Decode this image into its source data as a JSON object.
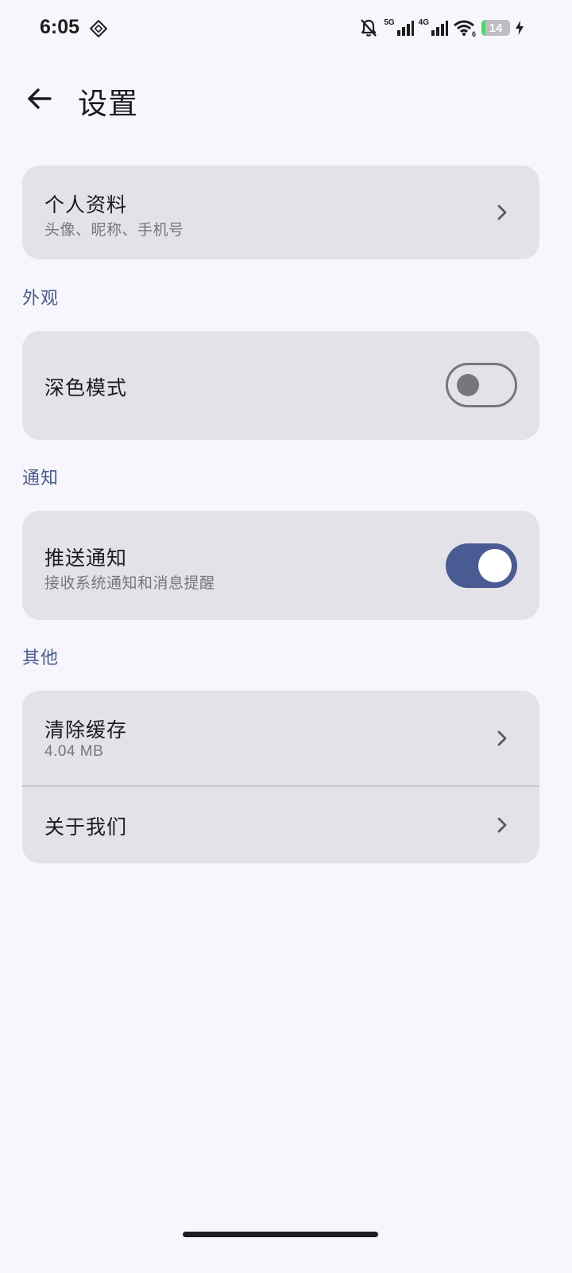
{
  "status_bar": {
    "time": "6:05",
    "net1": "5G",
    "net2": "4G",
    "wifi_badge": "6",
    "battery": "14",
    "battery_level_percent": 14,
    "battery_color": "#4cd964"
  },
  "header": {
    "title": "设置",
    "back_icon": "arrow-left-icon"
  },
  "profile": {
    "title": "个人资料",
    "subtitle": "头像、昵称、手机号"
  },
  "appearance": {
    "section": "外观",
    "dark_mode": {
      "label": "深色模式",
      "enabled": false
    }
  },
  "notifications": {
    "section": "通知",
    "push": {
      "label": "推送通知",
      "subtitle": "接收系统通知和消息提醒",
      "enabled": true
    }
  },
  "other": {
    "section": "其他",
    "clear_cache": {
      "label": "清除缓存",
      "value": "4.04 MB"
    },
    "about": {
      "label": "关于我们"
    }
  },
  "colors": {
    "accent": "#4a5a93",
    "section_label": "#4a5a8e",
    "card_bg": "#e3e2e8",
    "page_bg": "#f7f6fc"
  }
}
